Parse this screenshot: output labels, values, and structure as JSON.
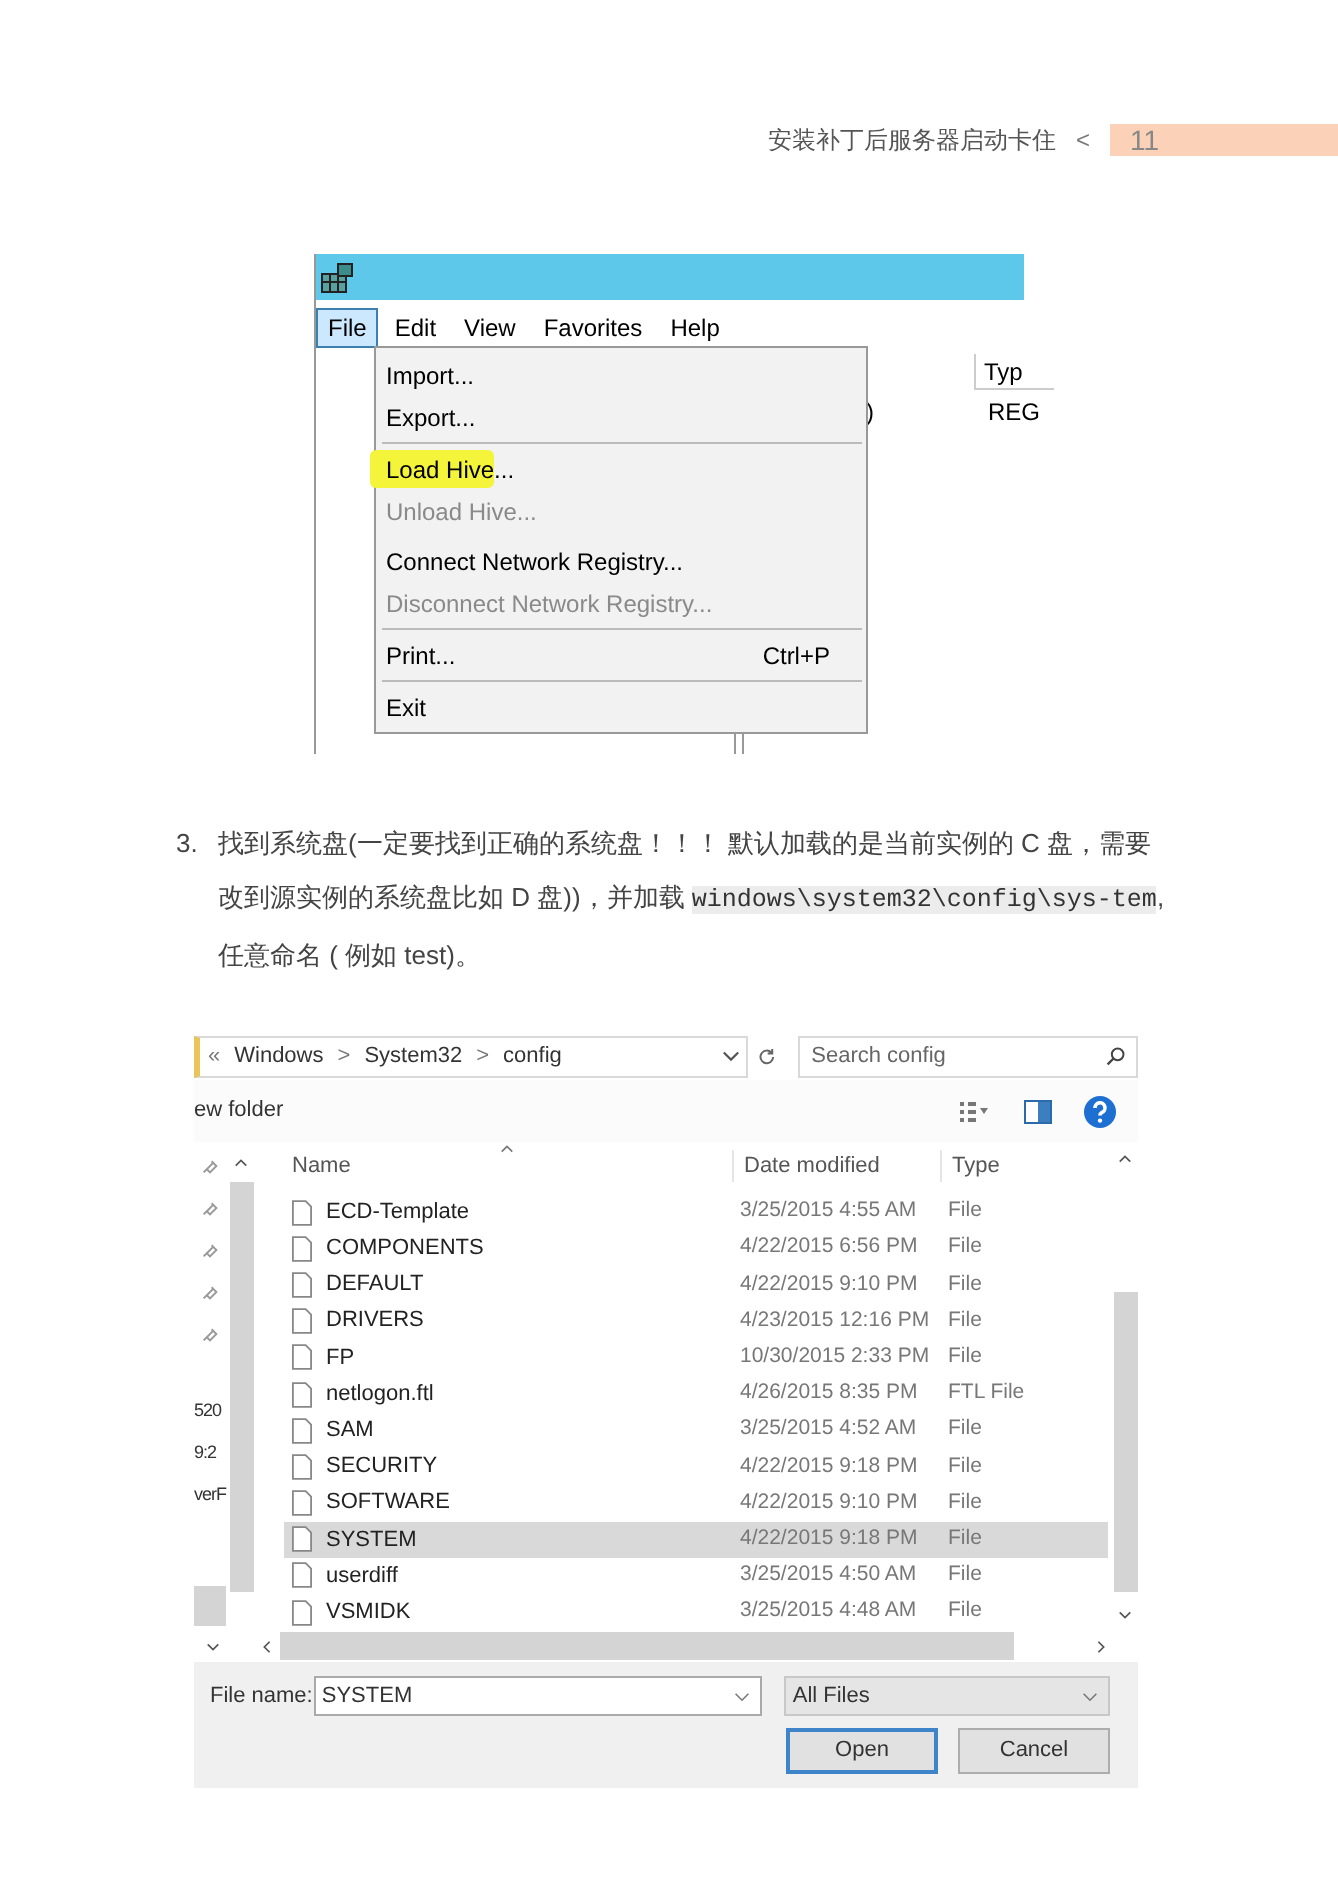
{
  "header": {
    "title": "安装补丁后服务器启动卡住",
    "separator": "<",
    "page_number": "11"
  },
  "regedit": {
    "menu": [
      {
        "label": "File",
        "selected": true
      },
      {
        "label": "Edit",
        "selected": false
      },
      {
        "label": "View",
        "selected": false
      },
      {
        "label": "Favorites",
        "selected": false
      },
      {
        "label": "Help",
        "selected": false
      }
    ],
    "dropdown": [
      {
        "kind": "item",
        "label": "Import...",
        "disabled": false,
        "highlighted": false
      },
      {
        "kind": "item",
        "label": "Export...",
        "disabled": false,
        "highlighted": false
      },
      {
        "kind": "separator"
      },
      {
        "kind": "item",
        "label": "Load Hive...",
        "disabled": false,
        "highlighted": true
      },
      {
        "kind": "item",
        "label": "Unload Hive...",
        "disabled": true,
        "highlighted": false
      },
      {
        "kind": "gap"
      },
      {
        "kind": "item",
        "label": "Connect Network Registry...",
        "disabled": false,
        "highlighted": false
      },
      {
        "kind": "item",
        "label": "Disconnect Network Registry...",
        "disabled": true,
        "highlighted": false
      },
      {
        "kind": "separator"
      },
      {
        "kind": "item",
        "label": "Print...",
        "shortcut": "Ctrl+P",
        "disabled": false,
        "highlighted": false
      },
      {
        "kind": "separator"
      },
      {
        "kind": "item",
        "label": "Exit",
        "disabled": false,
        "highlighted": false
      }
    ],
    "column_header": "Typ",
    "value_fragment": ")",
    "type_cell": "REG"
  },
  "step": {
    "number": "3.",
    "text_before": "找到系统盘(一定要找到正确的系统盘！！！ 默认加载的是当前实例的 C 盘，需要改到源实例的系统盘比如 D 盘))，并加载 ",
    "code": "windows\\system32\\config\\sys-tem",
    "text_after": ", 任意命名 ( 例如 test)。"
  },
  "file_dialog": {
    "breadcrumb": [
      "«",
      "Windows",
      ">",
      "System32",
      ">",
      "config"
    ],
    "search": {
      "placeholder": "Search config"
    },
    "toolbar_label": "ew folder",
    "nav_fragments": [
      "520",
      "9:2",
      "verF"
    ],
    "columns": [
      "Name",
      "Date modified",
      "Type"
    ],
    "rows": [
      {
        "name": "ECD-Template",
        "date": "3/25/2015 4:55 AM",
        "type": "File",
        "selected": false
      },
      {
        "name": "COMPONENTS",
        "date": "4/22/2015 6:56 PM",
        "type": "File",
        "selected": false
      },
      {
        "name": "DEFAULT",
        "date": "4/22/2015 9:10 PM",
        "type": "File",
        "selected": false
      },
      {
        "name": "DRIVERS",
        "date": "4/23/2015 12:16 PM",
        "type": "File",
        "selected": false
      },
      {
        "name": "FP",
        "date": "10/30/2015 2:33 PM",
        "type": "File",
        "selected": false
      },
      {
        "name": "netlogon.ftl",
        "date": "4/26/2015 8:35 PM",
        "type": "FTL File",
        "selected": false
      },
      {
        "name": "SAM",
        "date": "3/25/2015 4:52 AM",
        "type": "File",
        "selected": false
      },
      {
        "name": "SECURITY",
        "date": "4/22/2015 9:18 PM",
        "type": "File",
        "selected": false
      },
      {
        "name": "SOFTWARE",
        "date": "4/22/2015 9:10 PM",
        "type": "File",
        "selected": false
      },
      {
        "name": "SYSTEM",
        "date": "4/22/2015 9:18 PM",
        "type": "File",
        "selected": true
      },
      {
        "name": "userdiff",
        "date": "3/25/2015 4:50 AM",
        "type": "File",
        "selected": false
      },
      {
        "name": "VSMIDK",
        "date": "3/25/2015 4:48 AM",
        "type": "File",
        "selected": false
      }
    ],
    "file_name_label": "File name:",
    "file_name": "SYSTEM",
    "file_type": "All Files",
    "buttons": [
      {
        "label": "Open",
        "default": true
      },
      {
        "label": "Cancel",
        "default": false
      }
    ]
  }
}
